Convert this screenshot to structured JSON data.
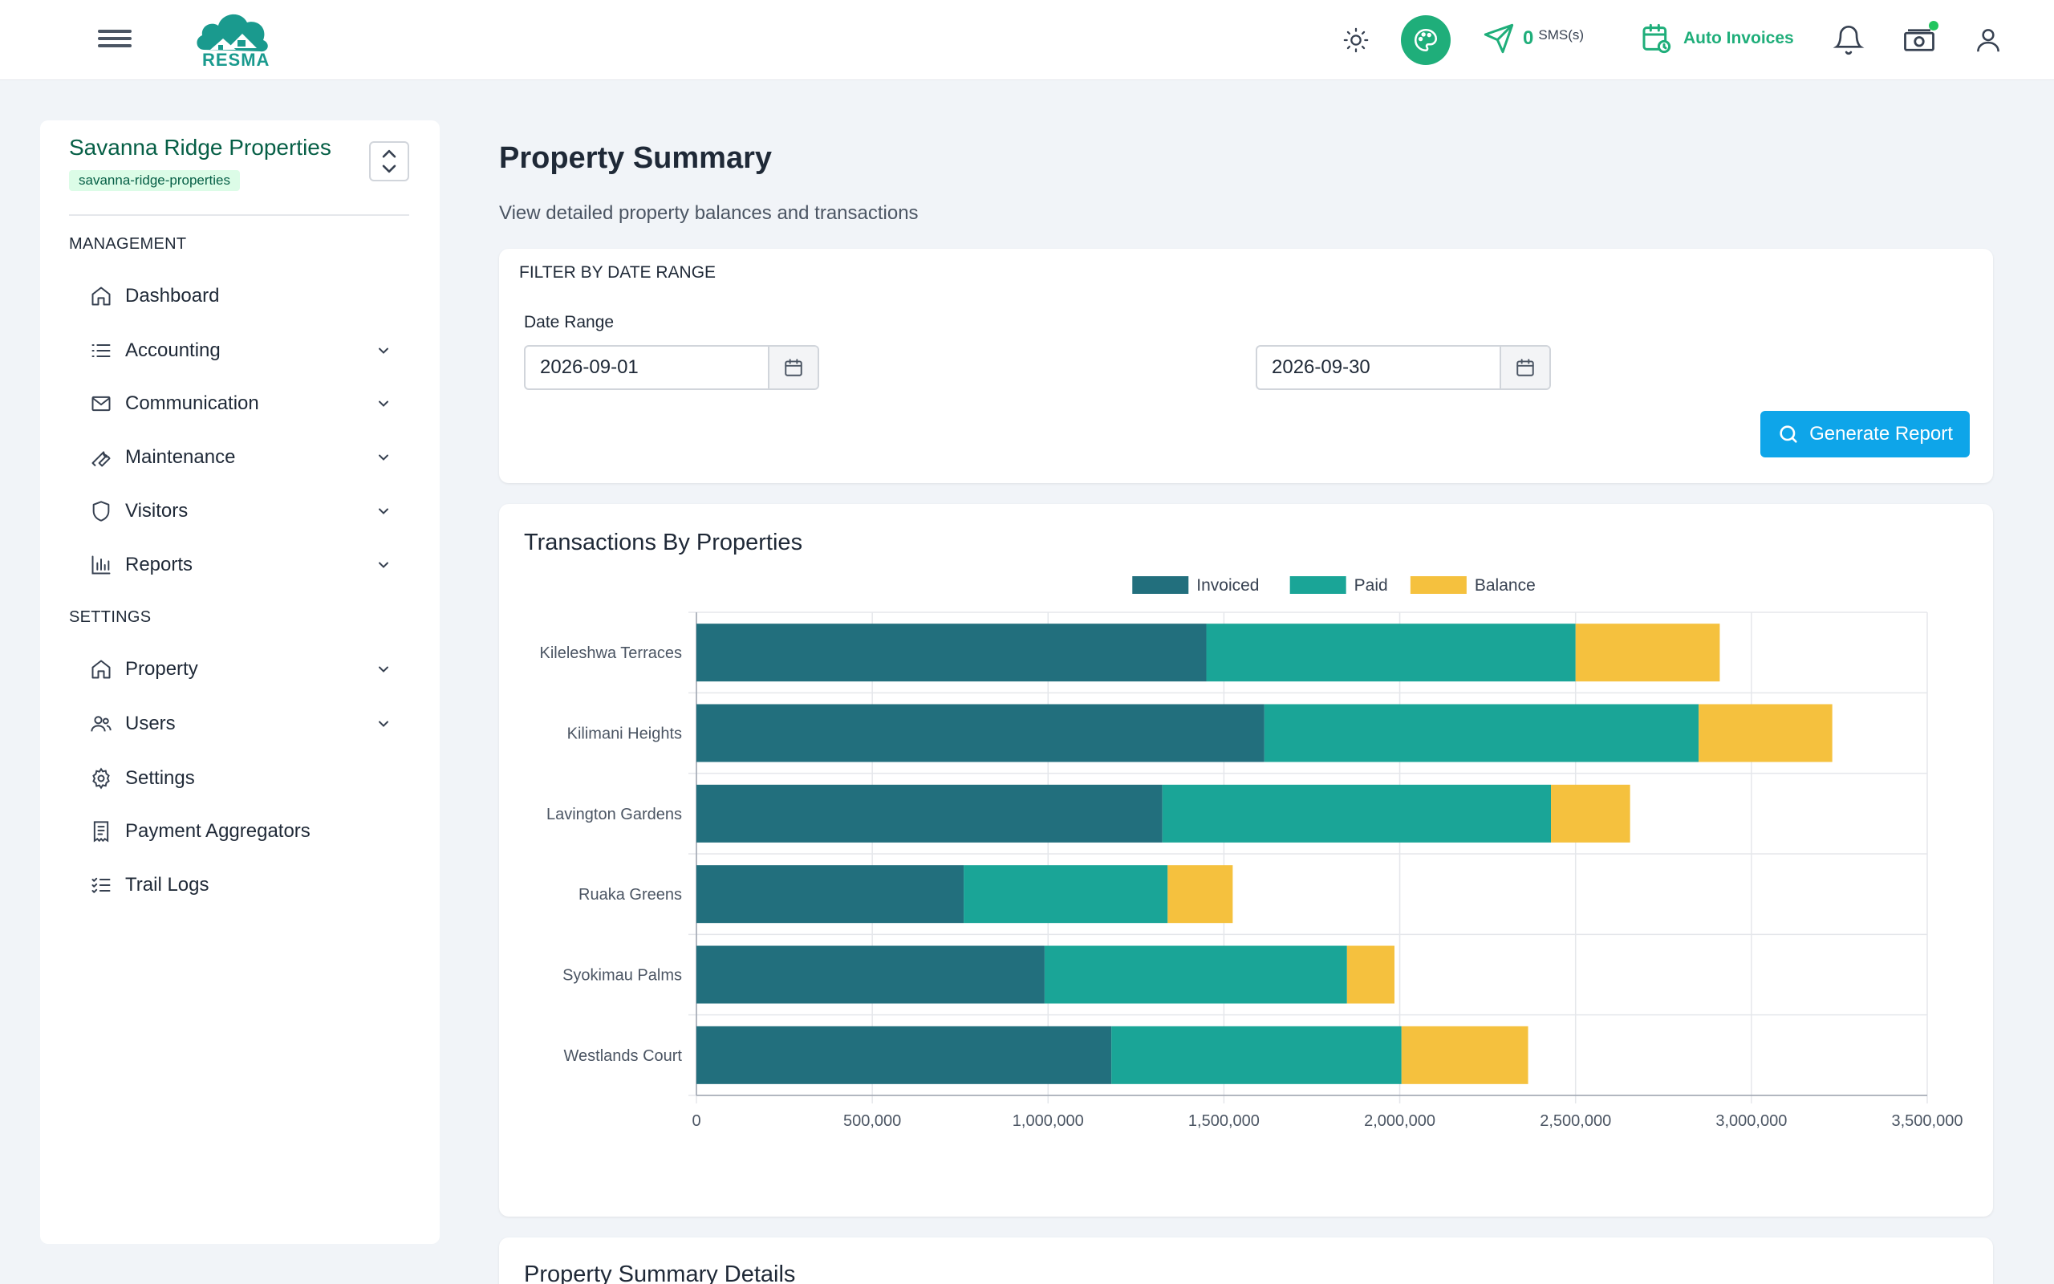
{
  "topbar": {
    "logo_text": "RESMA",
    "sms_count": "0",
    "sms_label": "SMS(s)",
    "auto_invoices": "Auto Invoices"
  },
  "sidebar": {
    "org_name": "Savanna Ridge Properties",
    "org_slug": "savanna-ridge-properties",
    "management_label": "MANAGEMENT",
    "settings_label": "SETTINGS",
    "management_items": [
      {
        "label": "Dashboard",
        "icon": "home-icon"
      },
      {
        "label": "Accounting",
        "icon": "list-icon"
      },
      {
        "label": "Communication",
        "icon": "mail-icon"
      },
      {
        "label": "Maintenance",
        "icon": "wrench-icon"
      },
      {
        "label": "Visitors",
        "icon": "shield-icon"
      },
      {
        "label": "Reports",
        "icon": "bar-chart-icon"
      }
    ],
    "settings_items": [
      {
        "label": "Property",
        "icon": "home-icon"
      },
      {
        "label": "Users",
        "icon": "users-icon"
      },
      {
        "label": "Settings",
        "icon": "gear-icon"
      },
      {
        "label": "Payment Aggregators",
        "icon": "receipt-icon"
      },
      {
        "label": "Trail Logs",
        "icon": "checklist-icon"
      }
    ]
  },
  "page": {
    "title": "Property Summary",
    "subtitle": "View detailed property balances and transactions"
  },
  "filter": {
    "title": "FILTER BY DATE RANGE",
    "date_range_label": "Date Range",
    "start_date": "2026-09-01",
    "end_date": "2026-09-30",
    "generate_label": "Generate Report"
  },
  "chart_card": {
    "title": "Transactions By Properties"
  },
  "details_card": {
    "title": "Property Summary Details"
  },
  "colors": {
    "invoiced": "#226f7d",
    "paid": "#1aa597",
    "balance": "#f5c13e",
    "accent_green": "#1fae7a",
    "button_blue": "#0ea5e9"
  },
  "chart_data": {
    "type": "bar",
    "orientation": "horizontal",
    "stacked": true,
    "categories": [
      "Kileleshwa Terraces",
      "Kilimani Heights",
      "Lavington Gardens",
      "Ruaka Greens",
      "Syokimau Palms",
      "Westlands Court"
    ],
    "series": [
      {
        "name": "Invoiced",
        "values": [
          1450000,
          1615000,
          1325000,
          760000,
          990000,
          1180000
        ]
      },
      {
        "name": "Paid",
        "values": [
          1050000,
          1235000,
          1105000,
          580000,
          860000,
          825000
        ]
      },
      {
        "name": "Balance",
        "values": [
          410000,
          380000,
          225000,
          185000,
          135000,
          360000
        ]
      }
    ],
    "xlim": [
      0,
      3500000
    ],
    "xticks": [
      "0",
      "500,000",
      "1,000,000",
      "1,500,000",
      "2,000,000",
      "2,500,000",
      "3,000,000",
      "3,500,000"
    ],
    "legend": "top-center",
    "grid": true
  }
}
